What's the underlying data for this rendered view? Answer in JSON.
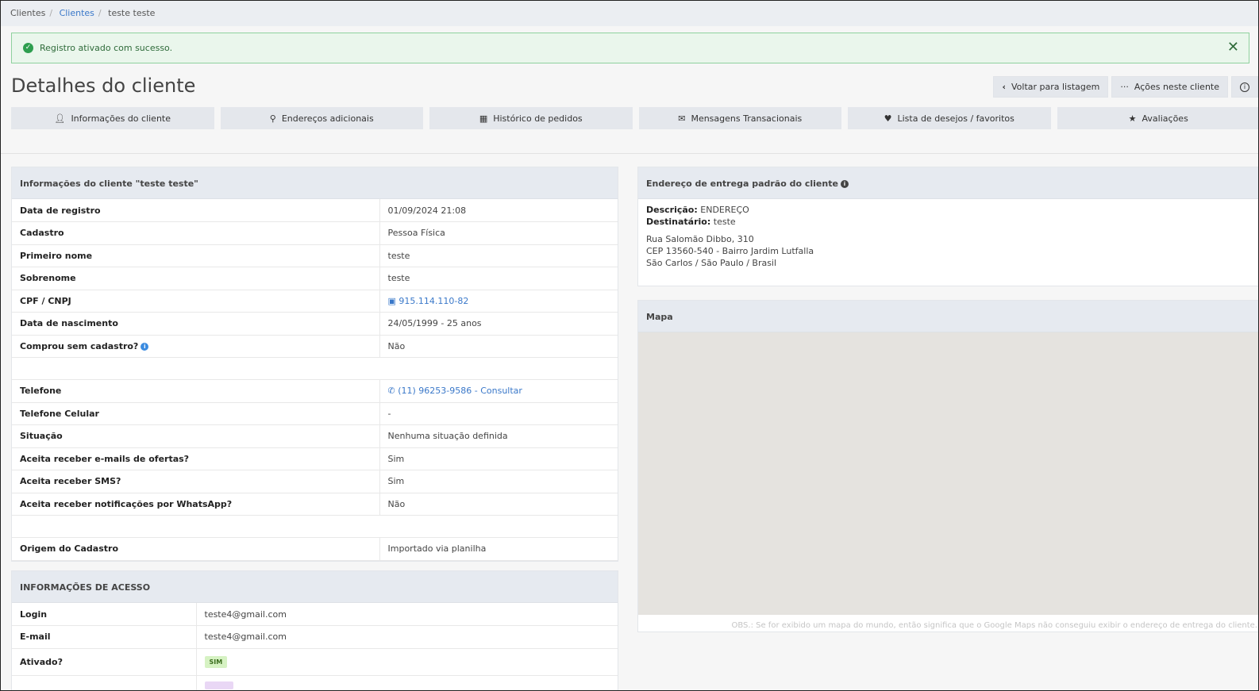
{
  "breadcrumb": {
    "items": [
      "Clientes",
      "Clientes",
      "teste teste"
    ]
  },
  "alert": {
    "message": "Registro ativado com sucesso.",
    "close": "✕"
  },
  "page": {
    "title": "Detalhes do cliente"
  },
  "actions": {
    "back_label": "Voltar para listagem",
    "actions_label": "Ações neste cliente",
    "info_icon": "info-icon"
  },
  "tabs": [
    {
      "label": "Informações do cliente",
      "icon": "user-icon"
    },
    {
      "label": "Endereços adicionais",
      "icon": "map-marker-icon"
    },
    {
      "label": "Histórico de pedidos",
      "icon": "calendar-icon"
    },
    {
      "label": "Mensagens Transacionais",
      "icon": "envelope-icon"
    },
    {
      "label": "Lista de desejos / favoritos",
      "icon": "heart-icon"
    },
    {
      "label": "Avaliações",
      "icon": "star-icon"
    }
  ],
  "client_info": {
    "title": "Informações do cliente \"teste teste\"",
    "rows": [
      {
        "label": "Data de registro",
        "value": "01/09/2024 21:08"
      },
      {
        "label": "Cadastro",
        "value": "Pessoa Física"
      },
      {
        "label": "Primeiro nome",
        "value": "teste"
      },
      {
        "label": "Sobrenome",
        "value": "teste"
      },
      {
        "label": "CPF / CNPJ",
        "value": "915.114.110-82"
      },
      {
        "label": "Data de nascimento",
        "value": "24/05/1999 - 25 anos"
      },
      {
        "label": "Comprou sem cadastro?",
        "value": "Não"
      },
      {
        "label": "Telefone",
        "value": "(11) 96253-9586 - Consultar"
      },
      {
        "label": "Telefone Celular",
        "value": "-"
      },
      {
        "label": "Situação",
        "value": "Nenhuma situação definida"
      },
      {
        "label": "Aceita receber e-mails de ofertas?",
        "value": "Sim"
      },
      {
        "label": "Aceita receber SMS?",
        "value": "Sim"
      },
      {
        "label": "Aceita receber notificações por WhatsApp?",
        "value": "Não"
      },
      {
        "label": "Origem do Cadastro",
        "value": "Importado via planilha"
      }
    ]
  },
  "access_info": {
    "title": "INFORMAÇÕES DE ACESSO",
    "rows": [
      {
        "label": "Login",
        "value": "teste4@gmail.com"
      },
      {
        "label": "E-mail",
        "value": "teste4@gmail.com"
      },
      {
        "label": "Ativado?",
        "value": "SIM"
      }
    ]
  },
  "address": {
    "title": "Endereço de entrega padrão do cliente",
    "desc_label": "Descrição:",
    "desc_value": "ENDEREÇO",
    "recipient_label": "Destinatário:",
    "recipient_value": "teste",
    "line1": "Rua Salomão Dibbo, 310",
    "line2": "CEP 13560-540 - Bairro Jardim Lutfalla",
    "line3": "São Carlos / São Paulo / Brasil"
  },
  "map": {
    "title": "Mapa",
    "note": "OBS.: Se for exibido um mapa do mundo, então significa que o Google Maps não conseguiu exibir o endereço de entrega do cliente."
  },
  "colors": {
    "link": "#3a78c9",
    "success": "#2e9e4f",
    "panel_head": "#e6eaf0"
  }
}
